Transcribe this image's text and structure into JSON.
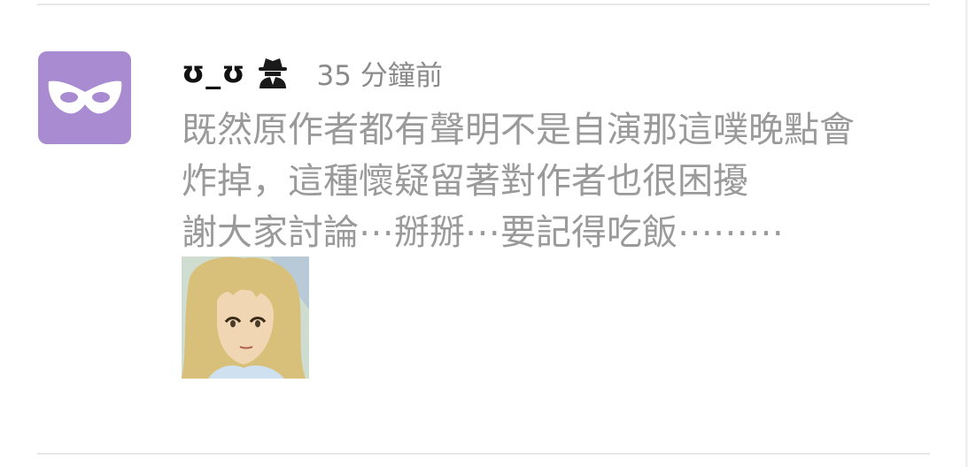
{
  "comment": {
    "username": "ʊ_ʊ",
    "badge_icon": "spy-icon",
    "timestamp": "35 分鐘前",
    "lines": [
      "既然原作者都有聲明不是自演那這噗晚點會",
      "炸掉，這種懷疑留著對作者也很困擾",
      "謝大家討論⋯掰掰⋯要記得吃飯⋯⋯⋯"
    ],
    "avatar_icon": "mask-icon",
    "sticker_icon": "anime-girl-sticker"
  },
  "colors": {
    "avatar_bg": "#a88bd0",
    "username": "#111111",
    "timestamp": "#8a8a8a",
    "body_text": "#9a9a9a",
    "divider": "#e7e7e7"
  }
}
